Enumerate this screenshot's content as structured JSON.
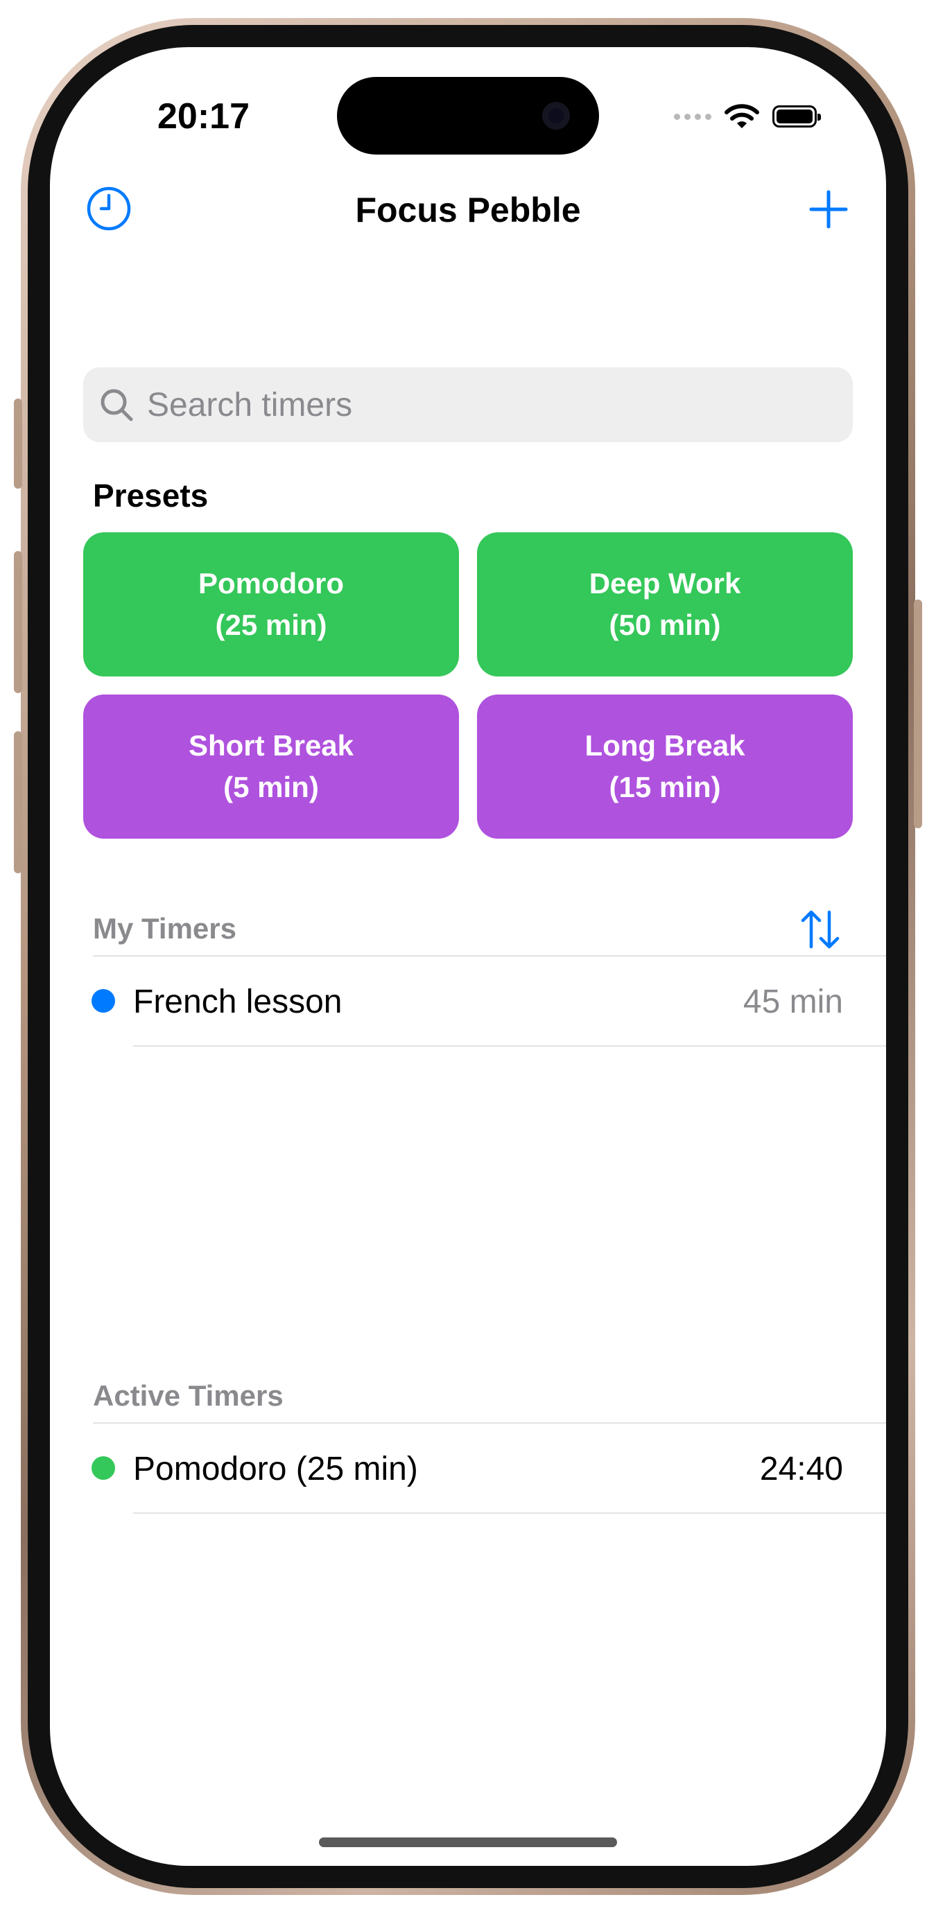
{
  "status_bar": {
    "time": "20:17"
  },
  "nav": {
    "title": "Focus Pebble",
    "left_icon": "clock-icon",
    "right_icon": "plus-icon"
  },
  "search": {
    "placeholder": "Search timers",
    "value": ""
  },
  "presets": {
    "title": "Presets",
    "items": [
      {
        "name": "Pomodoro",
        "duration": "(25 min)",
        "color": "#34c759"
      },
      {
        "name": "Deep Work",
        "duration": "(50 min)",
        "color": "#34c759"
      },
      {
        "name": "Short Break",
        "duration": "(5 min)",
        "color": "#af52de"
      },
      {
        "name": "Long Break",
        "duration": "(15 min)",
        "color": "#af52de"
      }
    ]
  },
  "my_timers": {
    "header": "My Timers",
    "sort_icon": "sort-arrows-icon",
    "items": [
      {
        "label": "French lesson",
        "value": "45 min",
        "dot_color": "#007aff"
      }
    ]
  },
  "active_timers": {
    "header": "Active Timers",
    "items": [
      {
        "label": "Pomodoro (25 min)",
        "value": "24:40",
        "dot_color": "#34c759"
      }
    ]
  },
  "colors": {
    "accent": "#007aff",
    "green": "#34c759",
    "purple": "#af52de"
  }
}
